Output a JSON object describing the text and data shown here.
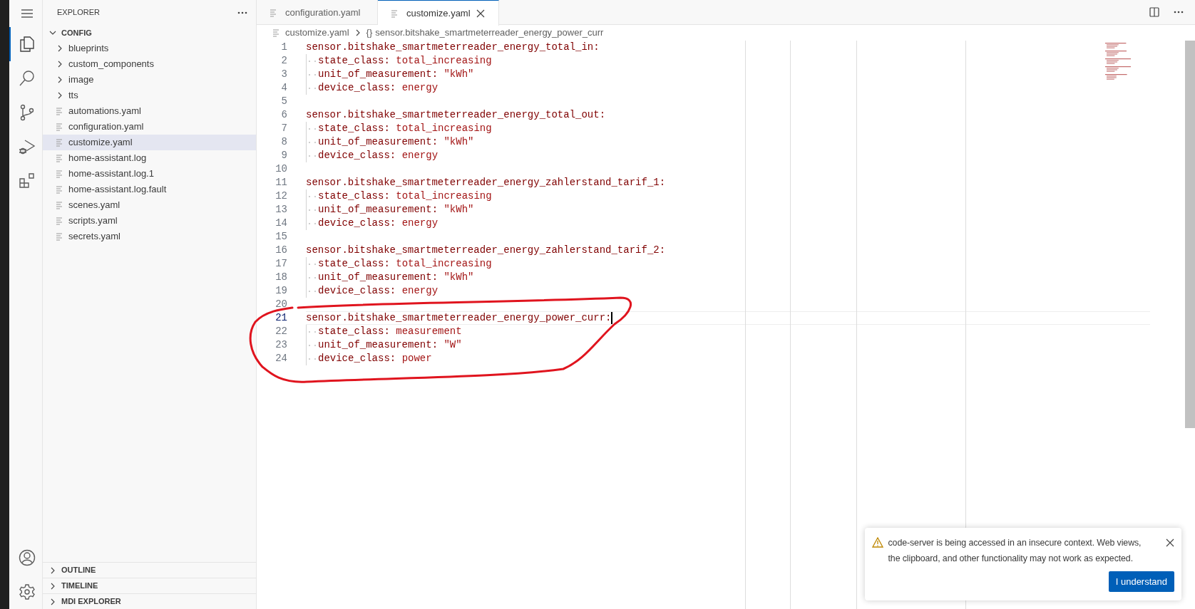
{
  "activity_bar": {
    "top": [
      {
        "kind": "menu",
        "selected": false
      },
      {
        "kind": "explorer",
        "selected": true
      },
      {
        "kind": "search",
        "selected": false
      },
      {
        "kind": "source-control",
        "selected": false
      },
      {
        "kind": "run-debug",
        "selected": false
      },
      {
        "kind": "extensions",
        "selected": false
      }
    ],
    "bottom": [
      {
        "kind": "account",
        "selected": false
      },
      {
        "kind": "settings",
        "selected": false
      }
    ]
  },
  "sidebar": {
    "title": "EXPLORER",
    "root": {
      "label": "CONFIG",
      "expanded": true
    },
    "items": [
      {
        "kind": "folder",
        "label": "blueprints",
        "selected": false
      },
      {
        "kind": "folder",
        "label": "custom_components",
        "selected": false
      },
      {
        "kind": "folder",
        "label": "image",
        "selected": false
      },
      {
        "kind": "folder",
        "label": "tts",
        "selected": false
      },
      {
        "kind": "file",
        "label": "automations.yaml",
        "selected": false
      },
      {
        "kind": "file",
        "label": "configuration.yaml",
        "selected": false
      },
      {
        "kind": "file",
        "label": "customize.yaml",
        "selected": true
      },
      {
        "kind": "file",
        "label": "home-assistant.log",
        "selected": false
      },
      {
        "kind": "file",
        "label": "home-assistant.log.1",
        "selected": false
      },
      {
        "kind": "file",
        "label": "home-assistant.log.fault",
        "selected": false
      },
      {
        "kind": "file",
        "label": "scenes.yaml",
        "selected": false
      },
      {
        "kind": "file",
        "label": "scripts.yaml",
        "selected": false
      },
      {
        "kind": "file",
        "label": "secrets.yaml",
        "selected": false
      }
    ],
    "sections": [
      {
        "label": "OUTLINE",
        "expanded": false
      },
      {
        "label": "TIMELINE",
        "expanded": false
      },
      {
        "label": "MDI EXPLORER",
        "expanded": false
      }
    ]
  },
  "tabs": [
    {
      "label": "configuration.yaml",
      "selected": false
    },
    {
      "label": "customize.yaml",
      "selected": true
    }
  ],
  "breadcrumb": {
    "file": "customize.yaml",
    "symbol": "{}",
    "path": "sensor.bitshake_smartmeterreader_energy_power_curr"
  },
  "lines": [
    {
      "number": "1",
      "key": "sensor.bitshake_smartmeterreader_energy_total_in:",
      "current": false,
      "children": [
        {
          "number": "2",
          "key": "state_class:",
          "value": "total_increasing"
        },
        {
          "number": "3",
          "key": "unit_of_measurement:",
          "value": "\"kWh\""
        },
        {
          "number": "4",
          "key": "device_class:",
          "value": "energy"
        }
      ]
    },
    {
      "number": "5",
      "current": false
    },
    {
      "number": "6",
      "key": "sensor.bitshake_smartmeterreader_energy_total_out:",
      "current": false,
      "children": [
        {
          "number": "7",
          "key": "state_class:",
          "value": "total_increasing"
        },
        {
          "number": "8",
          "key": "unit_of_measurement:",
          "value": "\"kWh\""
        },
        {
          "number": "9",
          "key": "device_class:",
          "value": "energy"
        }
      ]
    },
    {
      "number": "10",
      "current": false
    },
    {
      "number": "11",
      "key": "sensor.bitshake_smartmeterreader_energy_zahlerstand_tarif_1:",
      "current": false,
      "children": [
        {
          "number": "12",
          "key": "state_class:",
          "value": "total_increasing"
        },
        {
          "number": "13",
          "key": "unit_of_measurement:",
          "value": "\"kWh\""
        },
        {
          "number": "14",
          "key": "device_class:",
          "value": "energy"
        }
      ]
    },
    {
      "number": "15",
      "current": false
    },
    {
      "number": "16",
      "key": "sensor.bitshake_smartmeterreader_energy_zahlerstand_tarif_2:",
      "current": false,
      "children": [
        {
          "number": "17",
          "key": "state_class:",
          "value": "total_increasing"
        },
        {
          "number": "18",
          "key": "unit_of_measurement:",
          "value": "\"kWh\""
        },
        {
          "number": "19",
          "key": "device_class:",
          "value": "energy"
        }
      ]
    },
    {
      "number": "20",
      "current": false
    },
    {
      "number": "21",
      "key": "sensor.bitshake_smartmeterreader_energy_power_curr:",
      "current": true,
      "children": [
        {
          "number": "22",
          "key": "state_class:",
          "value": "measurement"
        },
        {
          "number": "23",
          "key": "unit_of_measurement:",
          "value": "\"W\""
        },
        {
          "number": "24",
          "key": "device_class:",
          "value": "power"
        }
      ]
    }
  ],
  "notification": {
    "message": "code-server is being accessed in an insecure context. Web views, the clipboard, and other functionality may not work as expected.",
    "button": "I understand"
  }
}
